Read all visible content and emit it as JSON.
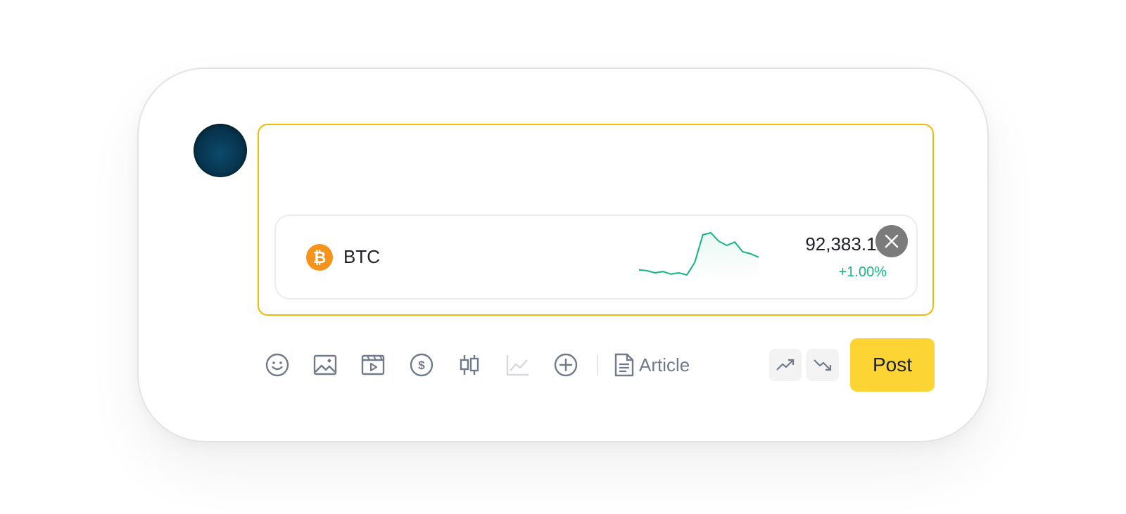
{
  "composer": {
    "text_placeholder": ""
  },
  "ticker": {
    "symbol": "BTC",
    "logo_glyph": "₿",
    "price": "92,383.12",
    "change": "+1.00%",
    "change_color": "#16b57f",
    "logo_color": "#f7931a",
    "sparkline_trend": [
      0.12,
      0.1,
      0.05,
      0.08,
      0.02,
      0.05,
      0.0,
      0.3,
      0.95,
      1.0,
      0.8,
      0.7,
      0.78,
      0.55,
      0.5,
      0.42
    ]
  },
  "toolbar": {
    "icons": [
      "emoji-icon",
      "image-icon",
      "video-icon",
      "dollar-icon",
      "candlestick-icon",
      "line-chart-icon",
      "plus-circle-icon"
    ],
    "article_label": "Article",
    "bullish_icon": "trend-up-icon",
    "bearish_icon": "trend-down-icon",
    "post_label": "Post"
  },
  "colors": {
    "accent_border": "#f0b90b",
    "post_button": "#fcd535",
    "icon_gray": "#707a8a",
    "disabled_icon": "#d5d7db"
  }
}
